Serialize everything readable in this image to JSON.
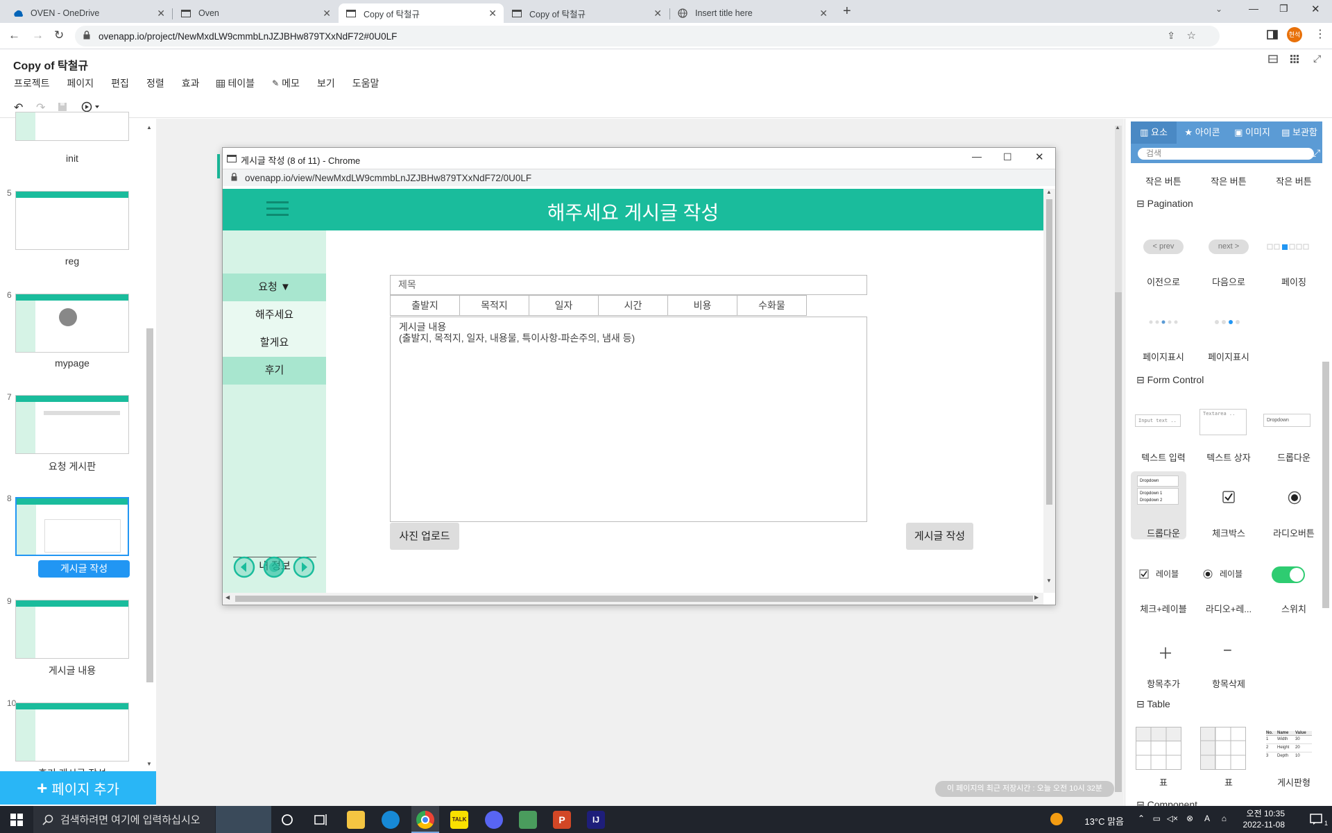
{
  "browser": {
    "tabs": [
      {
        "label": "OVEN - OneDrive",
        "icon": "onedrive-icon",
        "active": false
      },
      {
        "label": "Oven",
        "icon": "window-icon",
        "active": false
      },
      {
        "label": "Copy of 탁철규",
        "icon": "window-icon",
        "active": true
      },
      {
        "label": "Copy of 탁철규",
        "icon": "window-icon",
        "active": false
      },
      {
        "label": "Insert title here",
        "icon": "globe-icon",
        "active": false
      }
    ],
    "url": "ovenapp.io/project/NewMxdLW9cmmbLnJZJBHw879TXxNdF72#0U0LF",
    "profile": "현석"
  },
  "app": {
    "title": "Copy of 탁철규",
    "menu": [
      "프로젝트",
      "페이지",
      "편집",
      "정렬",
      "효과",
      "테이블",
      "메모",
      "보기",
      "도움말"
    ]
  },
  "pages": {
    "items": [
      {
        "num": "",
        "label": "init"
      },
      {
        "num": "5",
        "label": "reg"
      },
      {
        "num": "6",
        "label": "mypage"
      },
      {
        "num": "7",
        "label": "요청 게시판"
      },
      {
        "num": "8",
        "label": "게시글 작성"
      },
      {
        "num": "9",
        "label": "게시글 내용"
      },
      {
        "num": "10",
        "label": "후기 게시글 작성"
      }
    ],
    "add_label": "페이지 추가"
  },
  "popup": {
    "title": "게시글 작성 (8 of 11) - Chrome",
    "url": "ovenapp.io/view/NewMxdLW9cmmbLnJZJBHw879TXxNdF72/0U0LF",
    "header": "해주세요 게시글 작성",
    "nav": {
      "request": "요청 ▼",
      "do_for_me": "해주세요",
      "will_do": "할게요",
      "review": "후기",
      "bottom_label": "내 정보"
    },
    "title_placeholder": "제목",
    "columns": [
      "출발지",
      "목적지",
      "일자",
      "시간",
      "비용",
      "수화물"
    ],
    "content_line1": "게시글 내용",
    "content_line2": "(출발지, 목적지, 일자, 내용물, 특이사항-파손주의, 냄새 등)",
    "upload_button": "사진 업로드",
    "submit_button": "게시글 작성"
  },
  "rightpanel": {
    "tabs": [
      "요소",
      "아이콘",
      "이미지",
      "보관함"
    ],
    "search_placeholder": "검색",
    "small_buttons": [
      "작은 버튼",
      "작은 버튼",
      "작은 버튼"
    ],
    "sections": {
      "pagination": "Pagination",
      "form": "Form Control",
      "table": "Table",
      "component": "Component"
    },
    "pagination_items": {
      "prev_btn": "< prev",
      "next_btn": "next >",
      "labels": [
        "이전으로",
        "다음으로",
        "페이징",
        "페이지표시",
        "페이지표시"
      ]
    },
    "form_items": {
      "input_preview": "Input text ..",
      "textarea_preview": "Textarea ..",
      "dropdown_preview": "Dropdown",
      "dropdown_open_preview": "Dropdown",
      "dropdown_option1": "Dropdown 1",
      "dropdown_option2": "Dropdown 2",
      "check_label_text": "레이블",
      "radio_label_text": "레이블",
      "labels": [
        "텍스트 입력",
        "텍스트 상자",
        "드롭다운",
        "드롭다운",
        "체크박스",
        "라디오버튼",
        "체크+레이블",
        "라디오+레...",
        "스위치",
        "항목추가",
        "항목삭제"
      ]
    },
    "table_items": {
      "labels": [
        "표",
        "표",
        "게시판형"
      ],
      "preview_headers": [
        "No.",
        "Name",
        "Value"
      ],
      "preview_rows": [
        [
          "1",
          "Width",
          "30"
        ],
        [
          "2",
          "Height",
          "20"
        ],
        [
          "3",
          "Depth",
          "10"
        ]
      ]
    },
    "save_notice": "이 페이지의 최근 저장시간 : 오늘 오전 10시 32분"
  },
  "taskbar": {
    "search_placeholder": "검색하려면 여기에 입력하십시오",
    "weather": "13°C 맑음",
    "ime": "A",
    "time": "오전 10:35",
    "date": "2022-11-08",
    "notifications": "1"
  },
  "colors": {
    "teal": "#1abc9c",
    "mint": "#d6f3e6",
    "accent_blue": "#2196f3",
    "panel_blue": "#5b9bd5"
  }
}
